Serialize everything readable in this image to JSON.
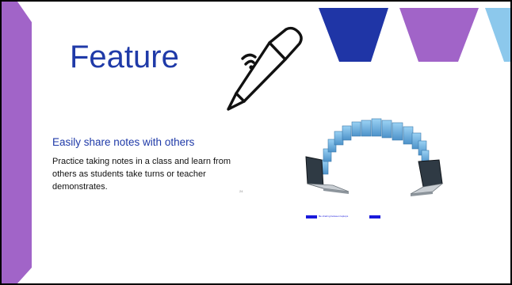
{
  "slide": {
    "title": "Feature",
    "subtitle": "Easily share notes with others",
    "body": "Practice taking notes in a class and learn from others as students take turns or teacher demonstrates.",
    "page_number": "24",
    "caption": "file sharing between laptops"
  },
  "colors": {
    "purple": "#a164c8",
    "blue": "#1f35a6",
    "light_blue": "#8cc8ec",
    "title_blue": "#1f3aa8"
  },
  "icons": {
    "pen": "wireless-smart-pen-icon",
    "illustration": "laptops-file-transfer-illustration"
  }
}
